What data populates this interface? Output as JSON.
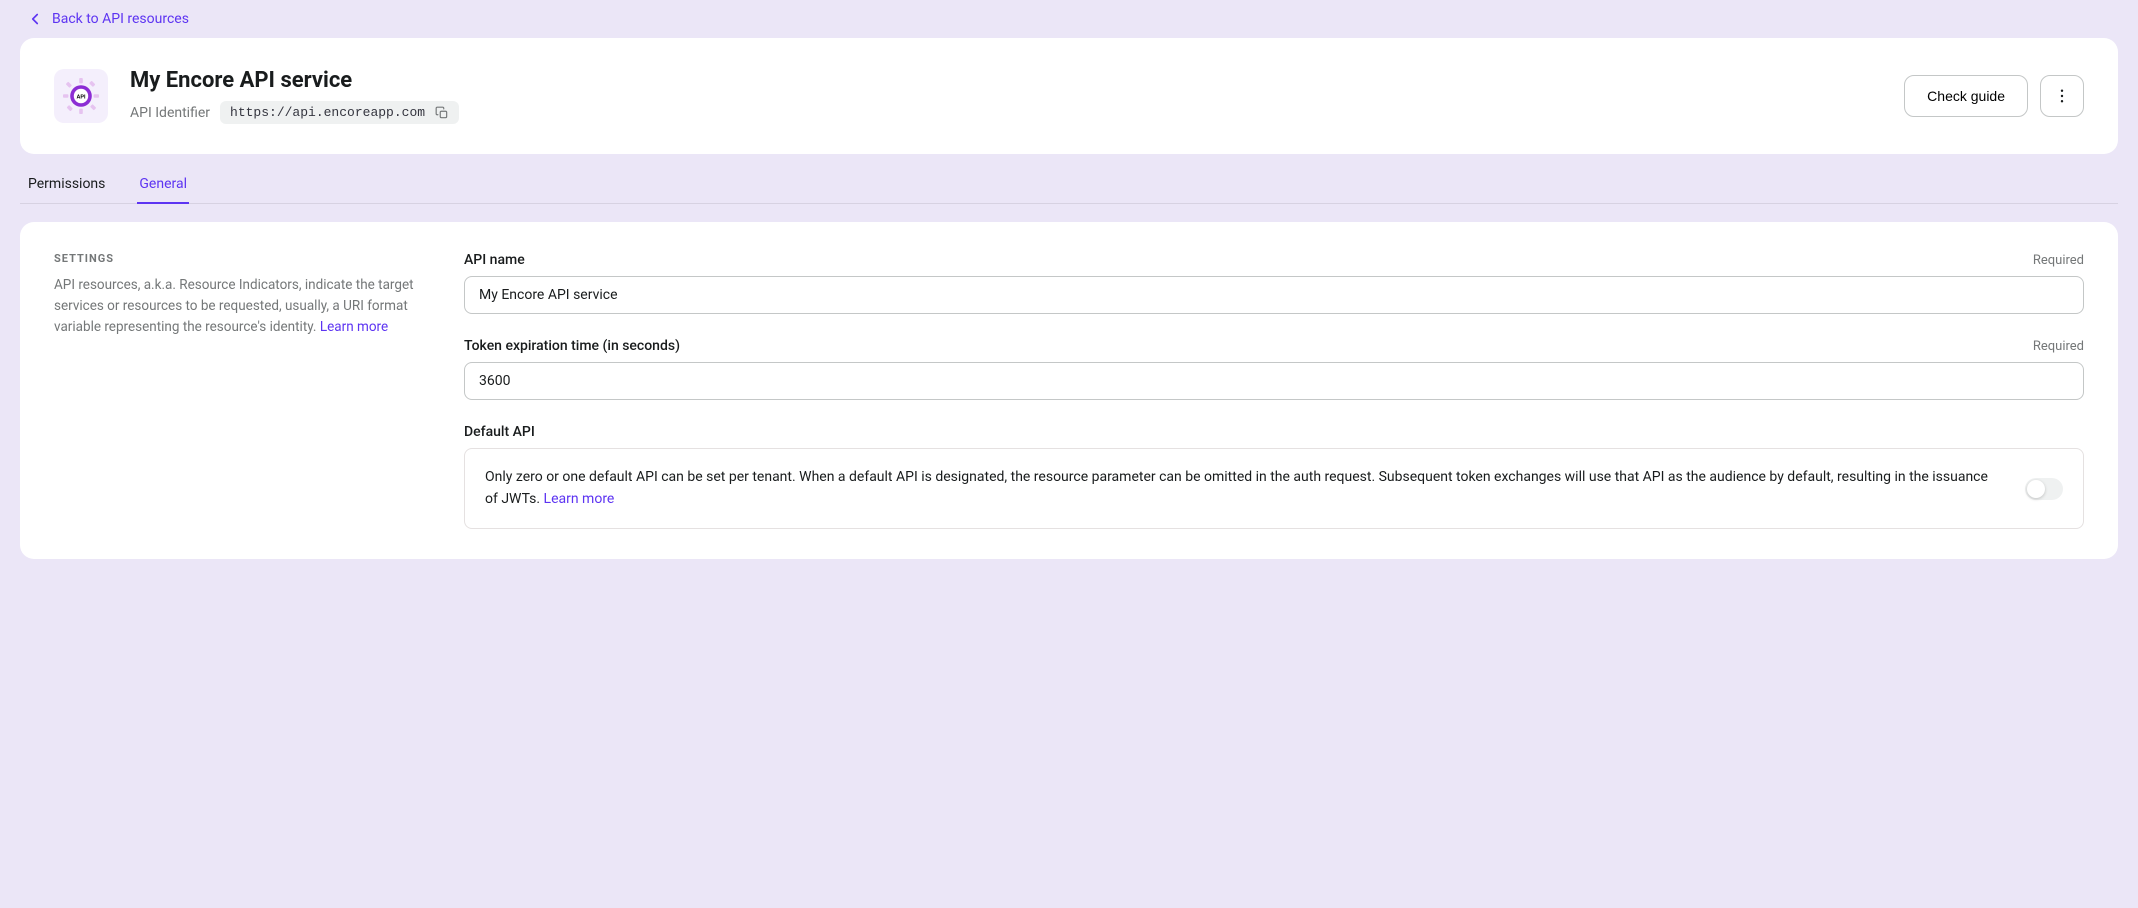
{
  "nav": {
    "back_label": "Back to API resources"
  },
  "header": {
    "title": "My Encore API service",
    "identifier_label": "API Identifier",
    "identifier_value": "https://api.encoreapp.com",
    "check_guide_label": "Check guide"
  },
  "tabs": [
    {
      "label": "Permissions",
      "active": false
    },
    {
      "label": "General",
      "active": true
    }
  ],
  "settings": {
    "heading": "SETTINGS",
    "description": "API resources, a.k.a. Resource Indicators, indicate the target services or resources to be requested, usually, a URI format variable representing the resource's identity.",
    "learn_more": "Learn more"
  },
  "form": {
    "api_name": {
      "label": "API name",
      "required": "Required",
      "value": "My Encore API service"
    },
    "token_exp": {
      "label": "Token expiration time (in seconds)",
      "required": "Required",
      "value": "3600"
    },
    "default_api": {
      "label": "Default API",
      "description": "Only zero or one default API can be set per tenant. When a default API is designated, the resource parameter can be omitted in the auth request. Subsequent token exchanges will use that API as the audience by default, resulting in the issuance of JWTs.",
      "learn_more": "Learn more",
      "enabled": false
    }
  }
}
